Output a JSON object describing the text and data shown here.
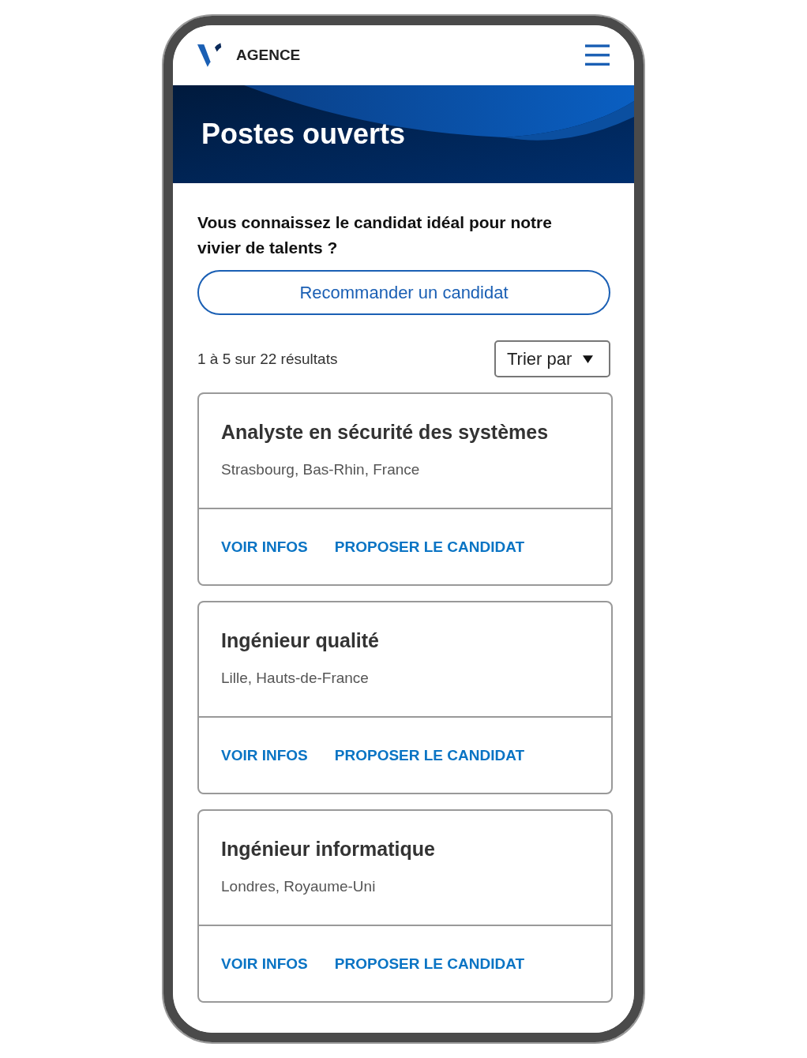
{
  "header": {
    "brand": "AGENCE"
  },
  "banner": {
    "title": "Postes ouverts"
  },
  "referral": {
    "prompt": "Vous connaissez le candidat idéal pour notre vivier de talents ?",
    "button": "Recommander un candidat"
  },
  "results": {
    "count": "1 à 5 sur 22 résultats",
    "sort_label": "Trier par"
  },
  "jobs": [
    {
      "title": "Analyste en sécurité des systèmes",
      "location": "Strasbourg, Bas-Rhin, France",
      "actions": [
        "VOIR INFOS",
        "PROPOSER LE CANDIDAT"
      ]
    },
    {
      "title": "Ingénieur qualité",
      "location": "Lille, Hauts-de-France",
      "actions": [
        "VOIR INFOS",
        "PROPOSER LE CANDIDAT"
      ]
    },
    {
      "title": "Ingénieur informatique",
      "location": "Londres, Royaume-Uni",
      "actions": [
        "VOIR INFOS",
        "PROPOSER LE CANDIDAT"
      ]
    }
  ]
}
